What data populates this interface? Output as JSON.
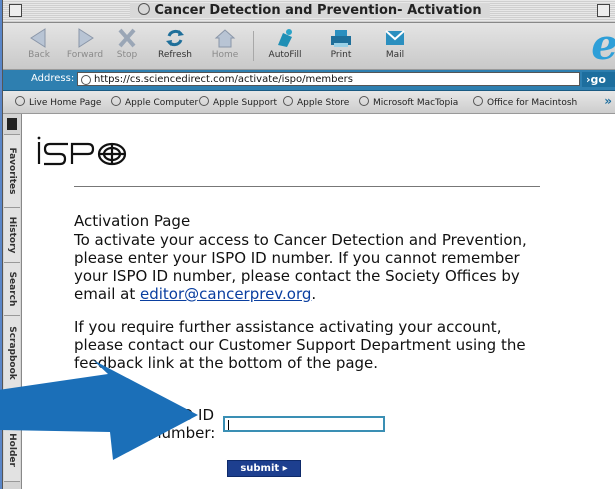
{
  "window": {
    "title": "Cancer Detection and Prevention- Activation"
  },
  "toolbar": {
    "back": "Back",
    "forward": "Forward",
    "stop": "Stop",
    "refresh": "Refresh",
    "home": "Home",
    "autofill": "AutoFill",
    "print": "Print",
    "mail": "Mail"
  },
  "address": {
    "label": "Address:",
    "url": "https://cs.sciencedirect.com/activate/ispo/members",
    "go": "go"
  },
  "favorites": [
    "Live Home Page",
    "Apple Computer",
    "Apple Support",
    "Apple Store",
    "Microsoft MacTopia",
    "Office for Macintosh"
  ],
  "sidetabs": [
    "Favorites",
    "History",
    "Search",
    "Scrapbook",
    "Page Holder"
  ],
  "page": {
    "heading": "Activation Page",
    "para1_pre": "To activate your access to Cancer Detection and Prevention, please enter your ISPO ID  number. If you cannot remember your ISPO ID number, please contact the Society Offices by email at ",
    "para1_link": "editor@cancerprev.org",
    "para1_post": ".",
    "para2": "If you require further assistance activating your account, please contact our Customer Support Department using the feedback link at the bottom of the page.",
    "field_label_1": "ISPO ID",
    "field_label_2": "number:",
    "input_value": "",
    "submit": "submit ▸"
  },
  "colors": {
    "addressbar": "#2e7fb0",
    "link": "#0a3fa0",
    "submit": "#1d3f8f",
    "arrow": "#1b6fb8"
  }
}
